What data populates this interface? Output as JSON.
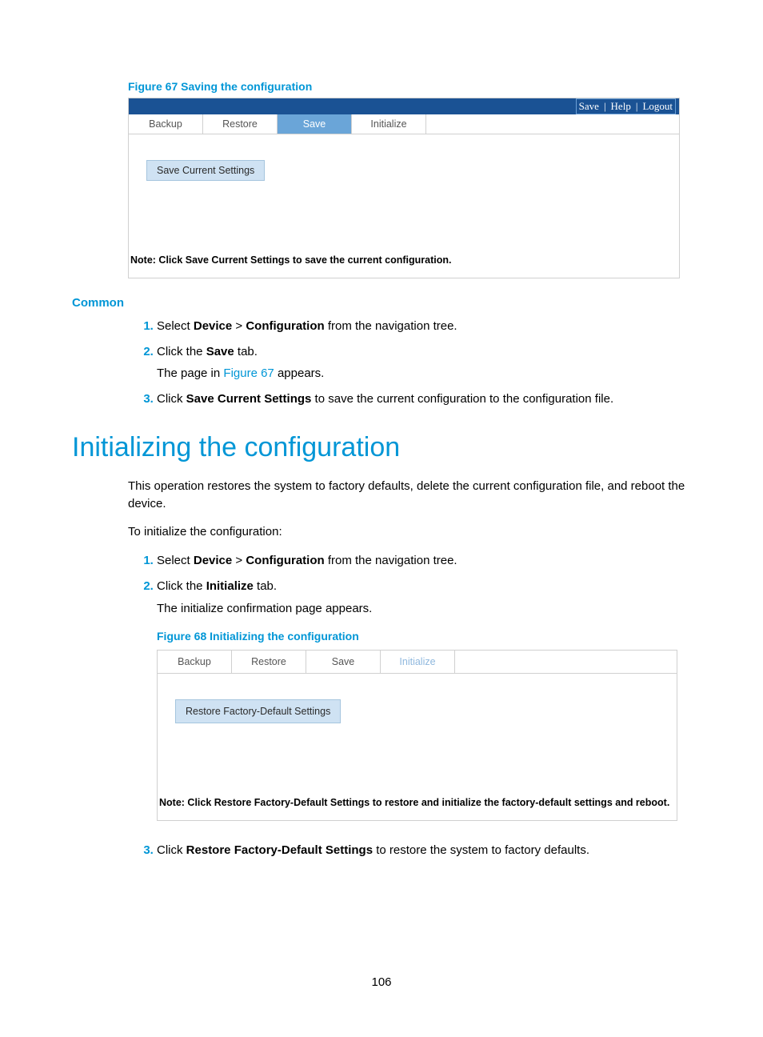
{
  "figure67": {
    "caption": "Figure 67 Saving the configuration",
    "topbar": {
      "save": "Save",
      "help": "Help",
      "logout": "Logout"
    },
    "tabs": {
      "backup": "Backup",
      "restore": "Restore",
      "save": "Save",
      "initialize": "Initialize"
    },
    "button": "Save Current Settings",
    "note": "Note: Click Save Current Settings to save the current configuration."
  },
  "commonHeading": "Common",
  "commonSteps": {
    "s1_a": "Select ",
    "s1_b": "Device",
    "s1_c": " > ",
    "s1_d": "Configuration",
    "s1_e": " from the navigation tree.",
    "s2_a": "Click the ",
    "s2_b": "Save",
    "s2_c": " tab.",
    "s2_sub_a": "The page in ",
    "s2_sub_link": "Figure 67",
    "s2_sub_b": " appears.",
    "s3_a": "Click ",
    "s3_b": "Save Current Settings",
    "s3_c": " to save the current configuration to the configuration file."
  },
  "title": "Initializing the configuration",
  "para1": "This operation restores the system to factory defaults, delete the current configuration file, and reboot the device.",
  "para2": "To initialize the configuration:",
  "initSteps": {
    "s1_a": "Select ",
    "s1_b": "Device",
    "s1_c": " > ",
    "s1_d": "Configuration",
    "s1_e": " from the navigation tree.",
    "s2_a": "Click the ",
    "s2_b": "Initialize",
    "s2_c": " tab.",
    "s2_sub": "The initialize confirmation page appears.",
    "s3_a": "Click ",
    "s3_b": "Restore Factory-Default Settings",
    "s3_c": " to restore the system to factory defaults."
  },
  "figure68": {
    "caption": "Figure 68 Initializing the configuration",
    "tabs": {
      "backup": "Backup",
      "restore": "Restore",
      "save": "Save",
      "initialize": "Initialize"
    },
    "button": "Restore Factory-Default Settings",
    "note": "Note: Click Restore Factory-Default Settings to restore and initialize the factory-default settings and reboot."
  },
  "pageNumber": "106"
}
